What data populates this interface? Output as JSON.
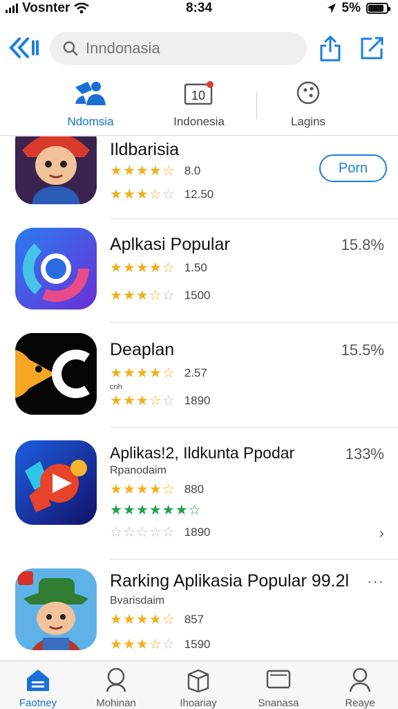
{
  "status_bar": {
    "carrier": "Vosnter",
    "time": "8:34",
    "battery": "5%",
    "battery_level": 0.85
  },
  "search": {
    "placeholder": "Inndonasia"
  },
  "segment_tabs": [
    {
      "label": "Ndomsia",
      "icon": "people-icon",
      "active": true
    },
    {
      "label": "Indonesia",
      "icon": "calendar-icon",
      "badge": "10"
    },
    {
      "label": "Lagins",
      "icon": "compass-icon"
    }
  ],
  "apps": [
    {
      "title": "Ildbarisia",
      "rating_line_1": {
        "stars": 4.5,
        "value": "8.0"
      },
      "rating_line_2": {
        "stars": 3.5,
        "value": "12.50"
      },
      "action": "Porn",
      "icon": "cartoon-character-icon",
      "accent": "#c8302a"
    },
    {
      "title": "Aplkasi Popular",
      "percent": "15.8%",
      "rating_line_1": {
        "stars": 4.5,
        "value": "1.50"
      },
      "rating_line_2": {
        "stars": 3.5,
        "value": "1500"
      },
      "icon": "browser-ring-icon",
      "accent": "#5a3fd9"
    },
    {
      "title": "Deaplan",
      "percent": "15.5%",
      "note": "cnh",
      "rating_line_1": {
        "stars": 4.5,
        "value": "2.57"
      },
      "rating_line_2": {
        "stars": 3.5,
        "value": "1890"
      },
      "icon": "pac-c-icon",
      "accent": "#f5a623"
    },
    {
      "title": "Aplikas!2, Ildkunta Ppodar",
      "percent": "133%",
      "subtitle": "Rpanodaim",
      "rating_line_1": {
        "stars": 4.5,
        "value": "880"
      },
      "rating_line_green": {
        "stars": 7
      },
      "rating_line_2": {
        "stars": 0,
        "value": "1890"
      },
      "icon": "media-play-icon",
      "accent": "#1e4fd6"
    },
    {
      "title": "Rarking Aplikasia Popular 99.2l",
      "subtitle": "Bvarisdaim",
      "rating_line_1": {
        "stars": 4.5,
        "value": "857"
      },
      "rating_line_2": {
        "stars": 3.5,
        "value": "1590"
      },
      "icon": "cartoon-hat-character-icon",
      "accent": "#2e7d32"
    }
  ],
  "tab_bar": [
    {
      "label": "Faotney",
      "icon": "home-icon",
      "active": true
    },
    {
      "label": "Mohinan",
      "icon": "search-person-icon"
    },
    {
      "label": "Ihoariay",
      "icon": "box-icon"
    },
    {
      "label": "Snanasa",
      "icon": "tablet-icon"
    },
    {
      "label": "Reaye",
      "icon": "person-icon"
    }
  ]
}
